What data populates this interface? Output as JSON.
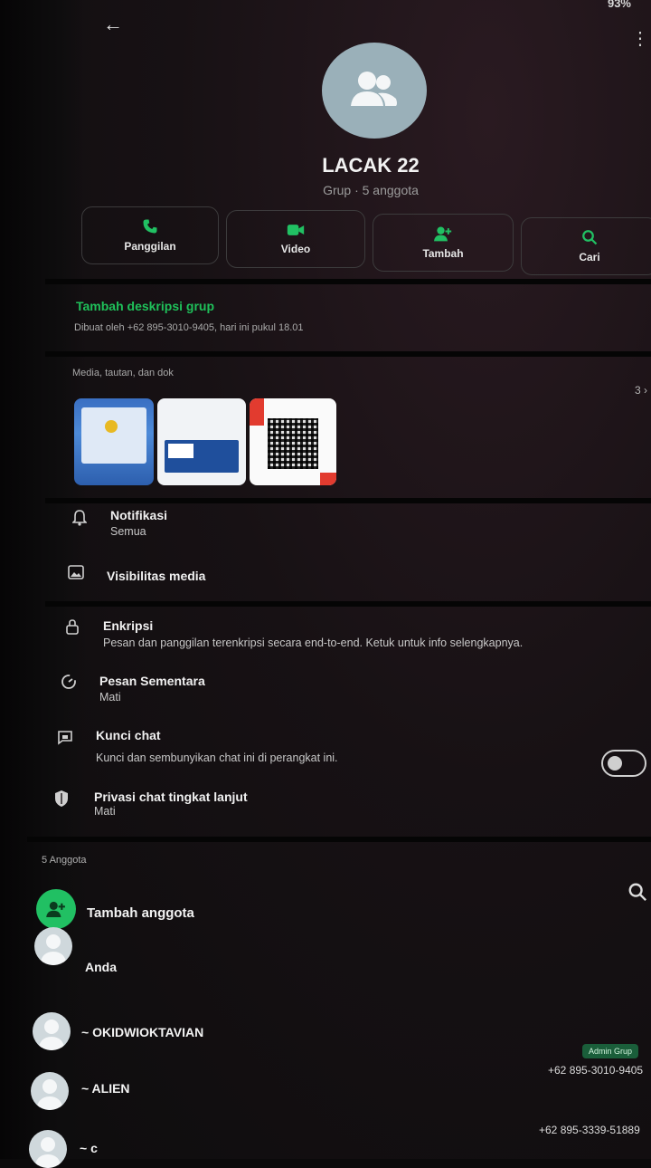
{
  "status_bar": {
    "battery": "93%"
  },
  "header": {
    "group_name": "LACAK 22",
    "group_subtitle": "Grup · 5 anggota"
  },
  "actions": [
    {
      "label": "Panggilan",
      "icon": "phone-icon"
    },
    {
      "label": "Video",
      "icon": "video-icon"
    },
    {
      "label": "Tambah",
      "icon": "add-person-icon"
    },
    {
      "label": "Cari",
      "icon": "search-icon"
    }
  ],
  "description": {
    "link": "Tambah deskripsi grup",
    "created_by": "Dibuat oleh +62 895-3010-9405, hari ini pukul 18.01"
  },
  "media": {
    "title": "Media, tautan, dan dok",
    "count": "3"
  },
  "settings": [
    {
      "title": "Notifikasi",
      "sub": "Semua",
      "icon": "bell-icon"
    },
    {
      "title": "Visibilitas media",
      "sub": "",
      "icon": "image-icon"
    },
    {
      "title": "Enkripsi",
      "sub": "Pesan dan panggilan terenkripsi secara end-to-end. Ketuk untuk info selengkapnya.",
      "icon": "lock-icon"
    },
    {
      "title": "Pesan Sementara",
      "sub": "Mati",
      "icon": "timer-icon"
    },
    {
      "title": "Kunci chat",
      "sub": "Kunci dan sembunyikan chat ini di perangkat ini.",
      "icon": "lock-chat-icon",
      "toggle": false
    },
    {
      "title": "Privasi chat tingkat lanjut",
      "sub": "Mati",
      "icon": "shield-icon"
    }
  ],
  "members": {
    "label": "5 Anggota",
    "add_label": "Tambah anggota",
    "list": [
      {
        "name": "Anda",
        "phone": ""
      },
      {
        "name": "~ OKIDWIOKTAVIAN",
        "phone": "+62 895-3010-9405",
        "badge": "Admin Grup"
      },
      {
        "name": "~ ALIEN",
        "phone": "+62 895-3339-51889"
      },
      {
        "name": "~ c",
        "phone": ""
      }
    ]
  }
}
